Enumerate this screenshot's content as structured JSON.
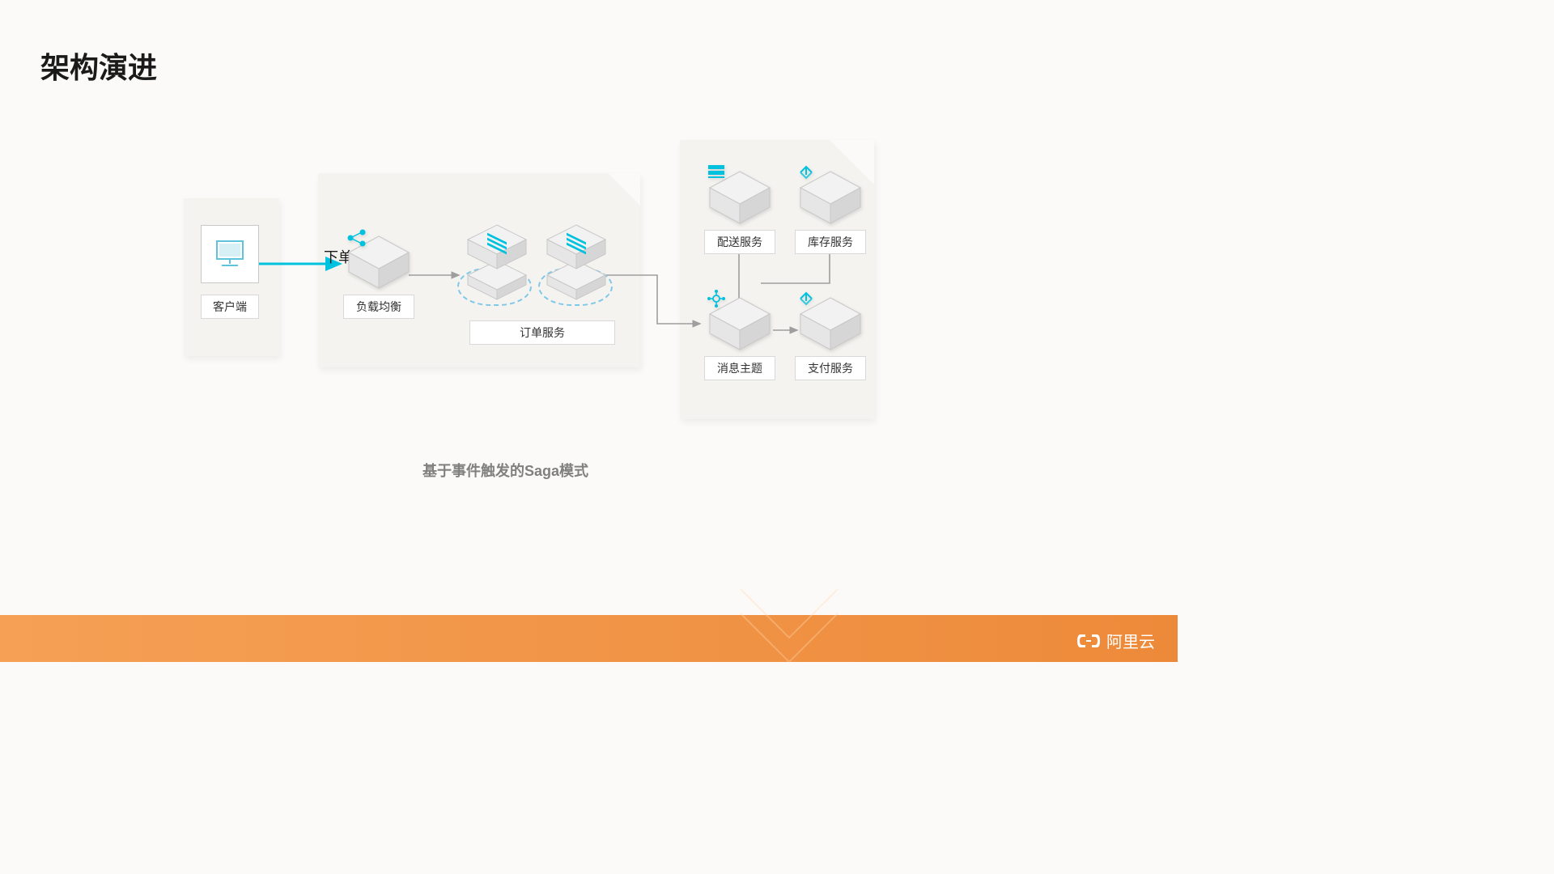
{
  "title": "架构演进",
  "caption": "基于事件触发的Saga模式",
  "arrow_label": "下单",
  "nodes": {
    "client": "客户端",
    "lb": "负载均衡",
    "order": "订单服务",
    "mq": "消息主题",
    "delivery": "配送服务",
    "inventory": "库存服务",
    "payment": "支付服务"
  },
  "brand": "阿里云",
  "colors": {
    "accent": "#00c1de",
    "accent2": "#4ab8d8",
    "footer": "#ed8a3a",
    "box_light": "#f7f7f7",
    "box_mid": "#e8e8e8",
    "box_dark": "#d0d0d0"
  }
}
